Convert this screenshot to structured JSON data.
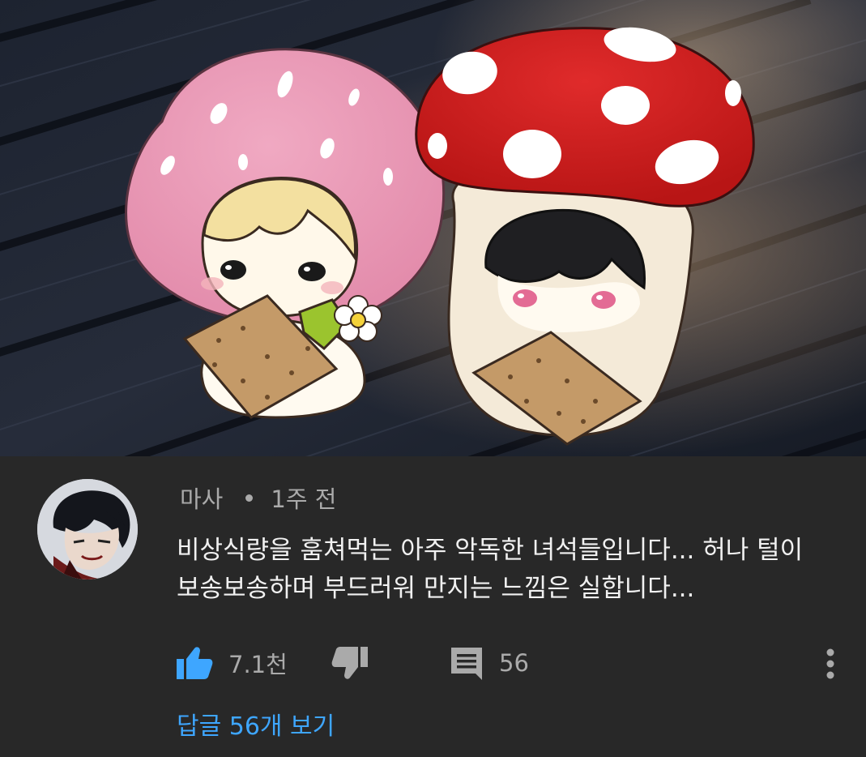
{
  "thumbnail": {
    "description_icon": "strawberry-and-mushroom-chibi-illustration"
  },
  "comment": {
    "author": "마사",
    "time": "1주 전",
    "text_line1": "비상식량을 훔쳐먹는 아주 악독한 녀석들입니다... 허나 털이",
    "text_line2": "보송보송하며 부드러워 만지는 느낌은 실합니다..."
  },
  "actions": {
    "like_count": "7.1천",
    "reply_count": "56",
    "like_icon": "thumbs-up-icon",
    "dislike_icon": "thumbs-down-icon",
    "reply_icon": "comment-icon",
    "more_icon": "more-vert-icon"
  },
  "replies": {
    "view_label": "답글 56개 보기"
  },
  "colors": {
    "background": "#282828",
    "accent": "#3ea6ff",
    "secondary_text": "#aaaaaa",
    "primary_text": "#f1f1f1"
  }
}
